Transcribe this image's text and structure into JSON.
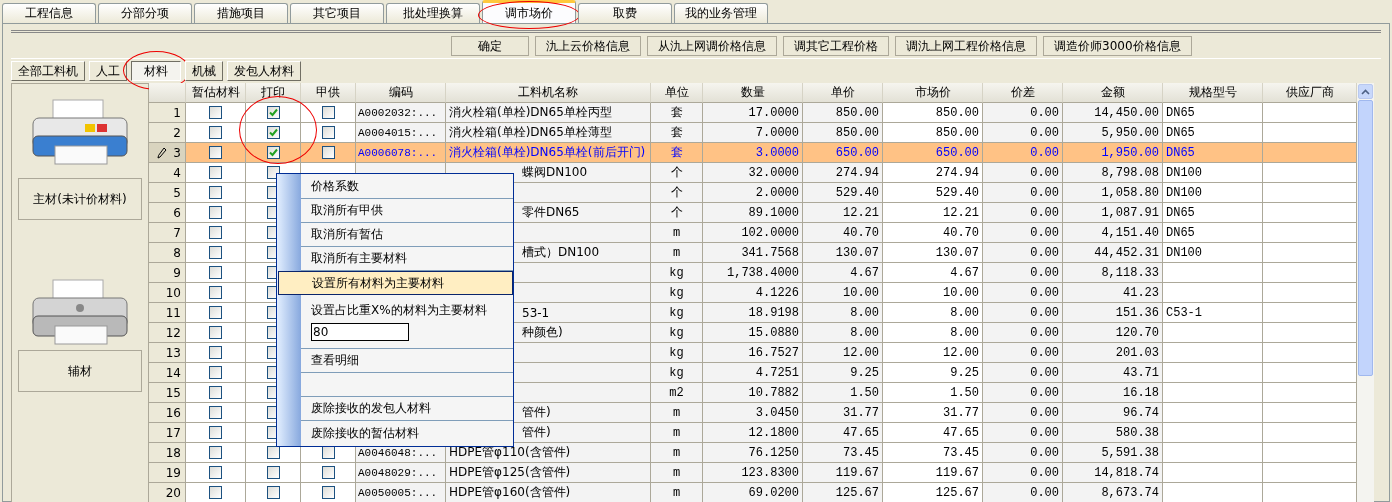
{
  "tabs": [
    {
      "label": "工程信息",
      "selected": false,
      "circled": false
    },
    {
      "label": "分部分项",
      "selected": false,
      "circled": false
    },
    {
      "label": "措施项目",
      "selected": false,
      "circled": false
    },
    {
      "label": "其它项目",
      "selected": false,
      "circled": false
    },
    {
      "label": "批处理换算",
      "selected": false,
      "circled": false
    },
    {
      "label": "调市场价",
      "selected": true,
      "circled": true
    },
    {
      "label": "取费",
      "selected": false,
      "circled": false
    },
    {
      "label": "我的业务管理",
      "selected": false,
      "circled": false
    }
  ],
  "toolbar": [
    "确定",
    "氿上云价格信息",
    "从氿上网调价格信息",
    "调其它工程价格",
    "调氿上网工程价格信息",
    "调造价师3000价格信息"
  ],
  "subtabs": [
    {
      "label": "全部工料机",
      "selected": false,
      "circled": false
    },
    {
      "label": "人工",
      "selected": false,
      "circled": false
    },
    {
      "label": "材料",
      "selected": true,
      "circled": true
    },
    {
      "label": "机械",
      "selected": false,
      "circled": false
    },
    {
      "label": "发包人材料",
      "selected": false,
      "circled": false
    }
  ],
  "side_buttons": [
    "主材(未计价材料)",
    "辅材"
  ],
  "columns": [
    {
      "label": "暂估材料",
      "circled": false
    },
    {
      "label": "打印",
      "circled": true
    },
    {
      "label": "甲供",
      "circled": false
    },
    {
      "label": "编码",
      "circled": false
    },
    {
      "label": "工料机名称",
      "circled": false
    },
    {
      "label": "单位",
      "circled": false
    },
    {
      "label": "数量",
      "circled": false
    },
    {
      "label": "单价",
      "circled": false
    },
    {
      "label": "市场价",
      "circled": false
    },
    {
      "label": "价差",
      "circled": false
    },
    {
      "label": "金额",
      "circled": false
    },
    {
      "label": "规格型号",
      "circled": false
    },
    {
      "label": "供应厂商",
      "circled": false
    }
  ],
  "rows": [
    {
      "kind": "full",
      "num": "1",
      "selected": false,
      "provisional": false,
      "print": true,
      "supplied": false,
      "code": "A0002032:...",
      "name": "消火栓箱(单栓)DN65单栓丙型",
      "unit": "套",
      "qty": "17.0000",
      "price": "850.00",
      "market": "850.00",
      "diff": "0.00",
      "amount": "14,450.00",
      "spec": "DN65"
    },
    {
      "kind": "full",
      "num": "2",
      "selected": false,
      "provisional": false,
      "print": true,
      "supplied": false,
      "code": "A0004015:...",
      "name": "消火栓箱(单栓)DN65单栓薄型",
      "unit": "套",
      "qty": "7.0000",
      "price": "850.00",
      "market": "850.00",
      "diff": "0.00",
      "amount": "5,950.00",
      "spec": "DN65"
    },
    {
      "kind": "full",
      "num": "3",
      "selected": true,
      "provisional": false,
      "print": true,
      "supplied": false,
      "code": "A0006078:...",
      "name": "消火栓箱(单栓)DN65单栓(前后开门)",
      "unit": "套",
      "qty": "3.0000",
      "price": "650.00",
      "market": "650.00",
      "diff": "0.00",
      "amount": "1,950.00",
      "spec": "DN65"
    },
    {
      "kind": "menu_edge",
      "num": "4",
      "selected": false,
      "provisional": false,
      "print": false,
      "name": "蝶阀DN100",
      "unit": "个",
      "qty": "32.0000",
      "price": "274.94",
      "market": "274.94",
      "diff": "0.00",
      "amount": "8,798.08",
      "spec": "DN100"
    },
    {
      "kind": "under_menu",
      "num": "5",
      "selected": false,
      "provisional": false,
      "print": false,
      "unit": "个",
      "qty": "2.0000",
      "price": "529.40",
      "market": "529.40",
      "diff": "0.00",
      "amount": "1,058.80",
      "spec": "DN100"
    },
    {
      "kind": "under_menu",
      "num": "6",
      "selected": false,
      "provisional": false,
      "print": false,
      "name": "零件DN65",
      "unit": "个",
      "qty": "89.1000",
      "price": "12.21",
      "market": "12.21",
      "diff": "0.00",
      "amount": "1,087.91",
      "spec": "DN65"
    },
    {
      "kind": "under_menu",
      "num": "7",
      "selected": false,
      "provisional": false,
      "print": false,
      "unit": "m",
      "qty": "102.0000",
      "price": "40.70",
      "market": "40.70",
      "diff": "0.00",
      "amount": "4,151.40",
      "spec": "DN65"
    },
    {
      "kind": "under_menu",
      "num": "8",
      "selected": false,
      "provisional": false,
      "print": false,
      "name": "槽式）DN100",
      "unit": "m",
      "qty": "341.7568",
      "price": "130.07",
      "market": "130.07",
      "diff": "0.00",
      "amount": "44,452.31",
      "spec": "DN100"
    },
    {
      "kind": "under_menu",
      "num": "9",
      "selected": false,
      "provisional": false,
      "print": false,
      "unit": "kg",
      "qty": "1,738.4000",
      "price": "4.67",
      "market": "4.67",
      "diff": "0.00",
      "amount": "8,118.33"
    },
    {
      "kind": "under_menu",
      "num": "10",
      "selected": false,
      "provisional": false,
      "print": false,
      "unit": "kg",
      "qty": "4.1226",
      "price": "10.00",
      "market": "10.00",
      "diff": "0.00",
      "amount": "41.23"
    },
    {
      "kind": "under_menu",
      "num": "11",
      "selected": false,
      "provisional": false,
      "print": false,
      "name": "53-1",
      "unit": "kg",
      "qty": "18.9198",
      "price": "8.00",
      "market": "8.00",
      "diff": "0.00",
      "amount": "151.36",
      "spec": "C53-1"
    },
    {
      "kind": "under_menu",
      "num": "12",
      "selected": false,
      "provisional": false,
      "print": false,
      "name": "种颜色)",
      "unit": "kg",
      "qty": "15.0880",
      "price": "8.00",
      "market": "8.00",
      "diff": "0.00",
      "amount": "120.70"
    },
    {
      "kind": "under_menu",
      "num": "13",
      "selected": false,
      "provisional": false,
      "print": false,
      "unit": "kg",
      "qty": "16.7527",
      "price": "12.00",
      "market": "12.00",
      "diff": "0.00",
      "amount": "201.03"
    },
    {
      "kind": "under_menu",
      "num": "14",
      "selected": false,
      "provisional": false,
      "print": false,
      "unit": "kg",
      "qty": "4.7251",
      "price": "9.25",
      "market": "9.25",
      "diff": "0.00",
      "amount": "43.71"
    },
    {
      "kind": "under_menu",
      "num": "15",
      "selected": false,
      "provisional": false,
      "print": false,
      "unit": "m2",
      "qty": "10.7882",
      "price": "1.50",
      "market": "1.50",
      "diff": "0.00",
      "amount": "16.18"
    },
    {
      "kind": "under_menu",
      "num": "16",
      "selected": false,
      "provisional": false,
      "print": false,
      "name": "管件)",
      "unit": "m",
      "qty": "3.0450",
      "price": "31.77",
      "market": "31.77",
      "diff": "0.00",
      "amount": "96.74"
    },
    {
      "kind": "under_menu",
      "num": "17",
      "selected": false,
      "provisional": false,
      "print": false,
      "name": "管件)",
      "unit": "m",
      "qty": "12.1800",
      "price": "47.65",
      "market": "47.65",
      "diff": "0.00",
      "amount": "580.38"
    },
    {
      "kind": "full",
      "num": "18",
      "selected": false,
      "provisional": false,
      "print": false,
      "supplied": false,
      "code": "A0046048:...",
      "name": "HDPE管φ110(含管件)",
      "unit": "m",
      "qty": "76.1250",
      "price": "73.45",
      "market": "73.45",
      "diff": "0.00",
      "amount": "5,591.38"
    },
    {
      "kind": "full",
      "num": "19",
      "selected": false,
      "provisional": false,
      "print": false,
      "supplied": false,
      "code": "A0048029:...",
      "name": "HDPE管φ125(含管件)",
      "unit": "m",
      "qty": "123.8300",
      "price": "119.67",
      "market": "119.67",
      "diff": "0.00",
      "amount": "14,818.74"
    },
    {
      "kind": "full",
      "num": "20",
      "selected": false,
      "provisional": false,
      "print": false,
      "supplied": false,
      "code": "A0050005:...",
      "name": "HDPE管φ160(含管件)",
      "unit": "m",
      "qty": "69.0200",
      "price": "125.67",
      "market": "125.67",
      "diff": "0.00",
      "amount": "8,673.74"
    }
  ],
  "context_menu": [
    {
      "kind": "item",
      "label": "价格系数",
      "selected": false
    },
    {
      "kind": "item",
      "label": "取消所有甲供",
      "selected": false
    },
    {
      "kind": "item",
      "label": "取消所有暂估",
      "selected": false
    },
    {
      "kind": "item",
      "label": "取消所有主要材料",
      "selected": false
    },
    {
      "kind": "item",
      "label": "设置所有材料为主要材料",
      "selected": true
    },
    {
      "kind": "input_item",
      "label": "设置占比重X%的材料为主要材料",
      "value": "80",
      "selected": false
    },
    {
      "kind": "item",
      "label": "查看明细",
      "selected": false
    },
    {
      "kind": "blank",
      "selected": false
    },
    {
      "kind": "item",
      "label": "废除接收的发包人材料",
      "selected": false
    },
    {
      "kind": "item",
      "label": "废除接收的暂估材料",
      "selected": false
    }
  ]
}
